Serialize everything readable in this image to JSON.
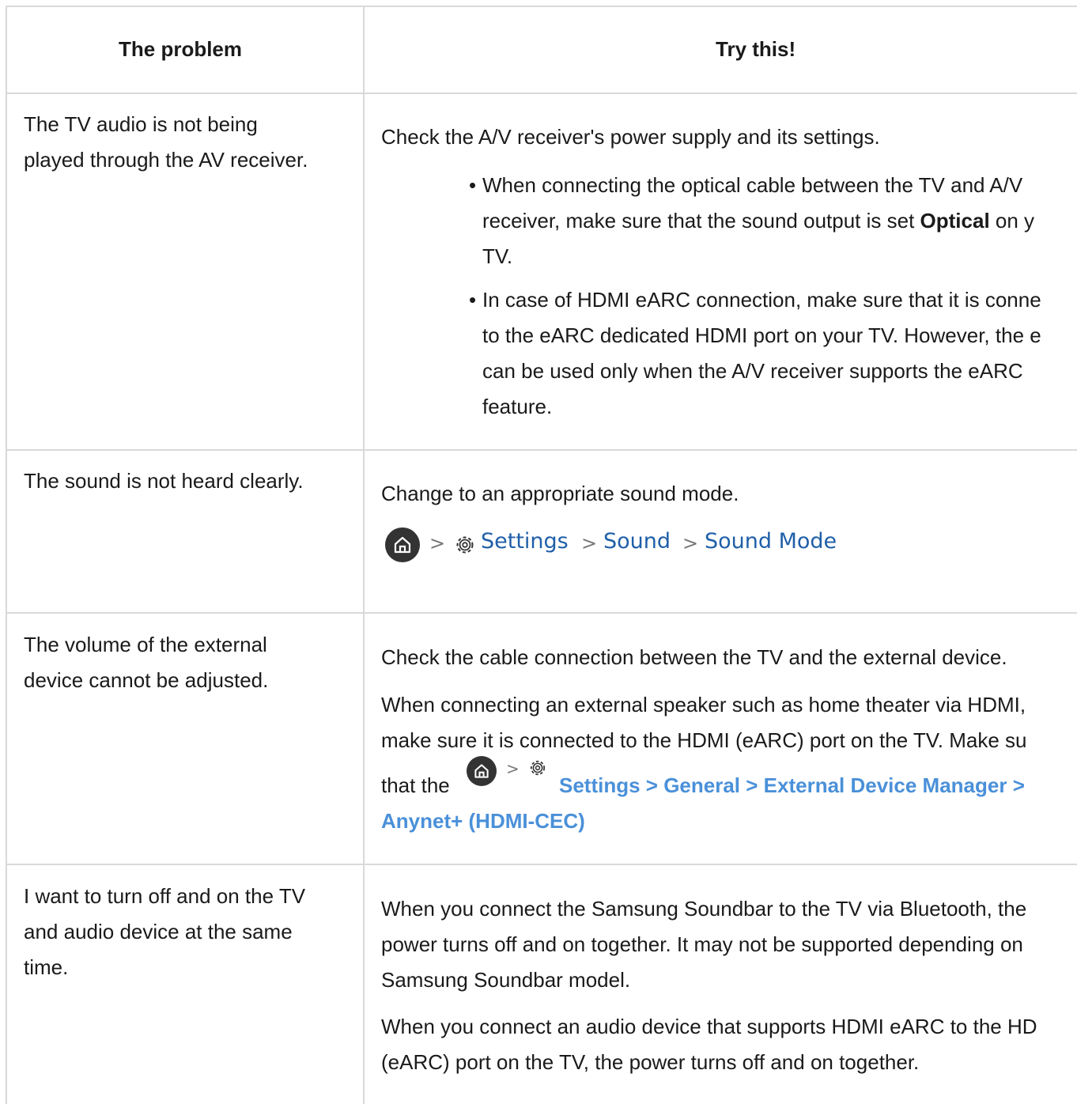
{
  "header": {
    "problem": "The problem",
    "try": "Try this!"
  },
  "rows": [
    {
      "problem": [
        "The TV audio is not being",
        "played through the AV receiver."
      ],
      "intro": "Check the A/V receiver's power supply and its settings.",
      "bullet1": {
        "line1": "When connecting the optical cable between the TV and A/V",
        "line2_pre": "receiver, make sure that the sound output is set ",
        "line2_bold": "Optical",
        "line2_post": " on y",
        "line3": "TV."
      },
      "bullet2": [
        "In case of HDMI eARC connection, make sure that it is conne",
        "to the eARC dedicated HDMI port on your TV. However, the e",
        "can be used only when the A/V receiver supports the eARC",
        "feature."
      ]
    },
    {
      "problem": [
        "The sound is not heard clearly."
      ],
      "intro": "Change to an appropriate sound mode.",
      "path": [
        "Settings",
        "Sound",
        "Sound Mode"
      ],
      "chevron": ">"
    },
    {
      "problem": [
        "The volume of the external",
        "device cannot be adjusted."
      ],
      "intro": "Check the cable connection between the TV and the external device.",
      "lines": [
        "When connecting an external speaker such as home theater via HDMI,",
        "make sure it is connected to the HDMI (eARC) port on the TV. Make su"
      ],
      "that_the": "that the",
      "link_line1": "Settings > General > External Device Manager >",
      "link_line2": "Anynet+ (HDMI-CEC)"
    },
    {
      "problem": [
        "I want to turn off and on the TV",
        "and audio device at the same",
        "time."
      ],
      "para1": [
        "When you connect the Samsung Soundbar to the TV via Bluetooth, the",
        "power turns off and on together. It may not be supported depending on",
        "Samsung Soundbar model."
      ],
      "para2": [
        "When you connect an audio device that supports HDMI eARC to the HD",
        "(eARC) port on the TV, the power turns off and on together."
      ]
    }
  ],
  "icons": {
    "home": "home-icon",
    "gear": "gear-icon"
  },
  "colors": {
    "link": "#4a90d9",
    "path": "#1f5fa8",
    "border": "#d9d9d9"
  }
}
